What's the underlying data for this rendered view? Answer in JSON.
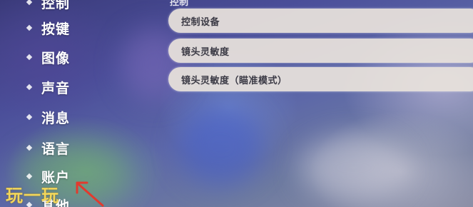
{
  "sidebar": {
    "items": [
      {
        "label": "控制"
      },
      {
        "label": "按键"
      },
      {
        "label": "图像"
      },
      {
        "label": "声音"
      },
      {
        "label": "消息"
      },
      {
        "label": "语言"
      },
      {
        "label": "账户"
      },
      {
        "label": "其他"
      }
    ]
  },
  "section": {
    "title": "控制"
  },
  "options": [
    {
      "label": "控制设备"
    },
    {
      "label": "镜头灵敏度"
    },
    {
      "label": "镜头灵敏度（瞄准模式）"
    }
  ],
  "watermark": {
    "text": "玩一玩"
  },
  "colors": {
    "option_bg": "#e8e2dc",
    "option_text": "#3b3a45",
    "sidebar_text": "#ffffff",
    "watermark": "#f3d65a",
    "arrow": "#e23a2e"
  },
  "icons": {
    "sidebar_bullet": "diamond-bullet-icon",
    "annotation": "red-arrow-icon"
  }
}
